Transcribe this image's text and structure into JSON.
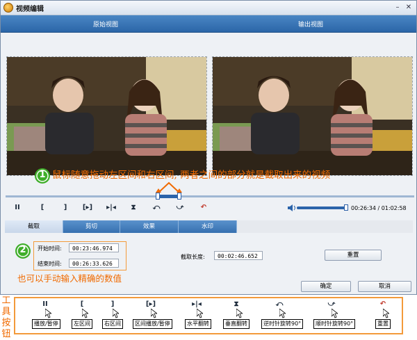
{
  "window": {
    "title": "视频编辑"
  },
  "view_bar": {
    "left": "原始视图",
    "right": "输出视图"
  },
  "annotation1": {
    "number": "1",
    "text": "鼠标随意拖动左区间和右区间, 两者之间的部分就是截取出来的视频"
  },
  "playback": {
    "time": "00:26:34 / 01:02:58"
  },
  "tabs": [
    "截取",
    "剪切",
    "效果",
    "水印"
  ],
  "clip": {
    "start_label": "开始时间:",
    "start_value": "00:23:46.974",
    "end_label": "结束时间:",
    "end_value": "00:26:33.626",
    "length_label": "截取长度:",
    "length_value": "00:02:46.652",
    "reset_label": "重置"
  },
  "annotation2": {
    "number": "2",
    "text": "也可以手动输入精确的数值"
  },
  "footer": {
    "ok_label": "确定",
    "cancel_label": "取消"
  },
  "toolbar_legend": {
    "heading": "工具按钮",
    "items": [
      {
        "symbol": "II",
        "label": "播放/暂停"
      },
      {
        "symbol": "[",
        "label": "左区间"
      },
      {
        "symbol": "]",
        "label": "右区间"
      },
      {
        "symbol": "[▸]",
        "label": "区间播放/暂停"
      },
      {
        "symbol": "▸|◂",
        "label": "水平翻转"
      },
      {
        "symbol": "⧗",
        "label": "垂直翻转"
      },
      {
        "symbol": "⤺",
        "label": "逆时针旋转90°"
      },
      {
        "symbol": "⤻",
        "label": "顺时针旋转90°"
      },
      {
        "symbol": "↶",
        "label": "重置"
      }
    ]
  },
  "colors": {
    "accent_orange": "#f06a00",
    "bar_blue": "#2b66a8"
  }
}
